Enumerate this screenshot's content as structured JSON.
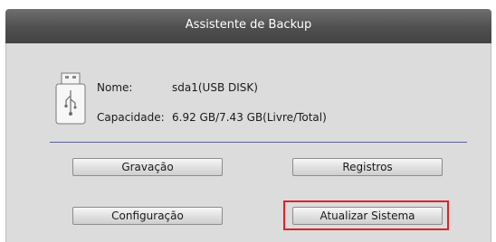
{
  "window": {
    "title": "Assistente de Backup"
  },
  "device": {
    "name_label": "Nome:",
    "name_value": "sda1(USB DISK)",
    "capacity_label": "Capacidade:",
    "capacity_value": "6.92 GB/7.43 GB(Livre/Total)",
    "icon": "usb-drive-icon"
  },
  "buttons": {
    "record": "Gravação",
    "logs": "Registros",
    "config": "Configuração",
    "update": "Atualizar Sistema"
  },
  "colors": {
    "highlight": "#e0222a",
    "titlebar": "#4f4f4f",
    "panel": "#dcdcdc"
  }
}
